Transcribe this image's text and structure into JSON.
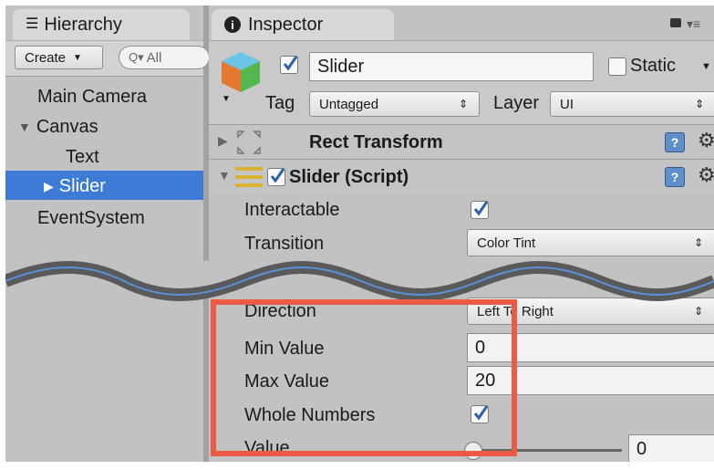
{
  "hierarchy": {
    "tab_label": "Hierarchy",
    "tab_icon": "list-icon",
    "create_label": "Create",
    "search_placeholder": "All",
    "items": [
      {
        "label": "Main Camera"
      },
      {
        "label": "Canvas"
      },
      {
        "label": "Text"
      },
      {
        "label": "Slider"
      },
      {
        "label": "EventSystem"
      }
    ]
  },
  "inspector": {
    "tab_label": "Inspector",
    "tab_icon": "info-icon",
    "object_name": "Slider",
    "static_label": "Static",
    "tag_label": "Tag",
    "tag_value": "Untagged",
    "layer_label": "Layer",
    "layer_value": "UI",
    "components": [
      {
        "title": "Rect Transform"
      },
      {
        "title": "Slider (Script)"
      }
    ],
    "fields": {
      "interactable_label": "Interactable",
      "transition_label": "Transition",
      "transition_value": "Color Tint",
      "direction_label": "Direction",
      "direction_value": "Left To Right",
      "min_label": "Min Value",
      "min_value": "0",
      "max_label": "Max Value",
      "max_value": "20",
      "whole_label": "Whole Numbers",
      "value_label": "Value",
      "value_value": "0"
    }
  },
  "colors": {
    "selection": "#3e7bd6",
    "highlight_box": "#ea5a47",
    "wave_blue": "#5a93d8"
  }
}
